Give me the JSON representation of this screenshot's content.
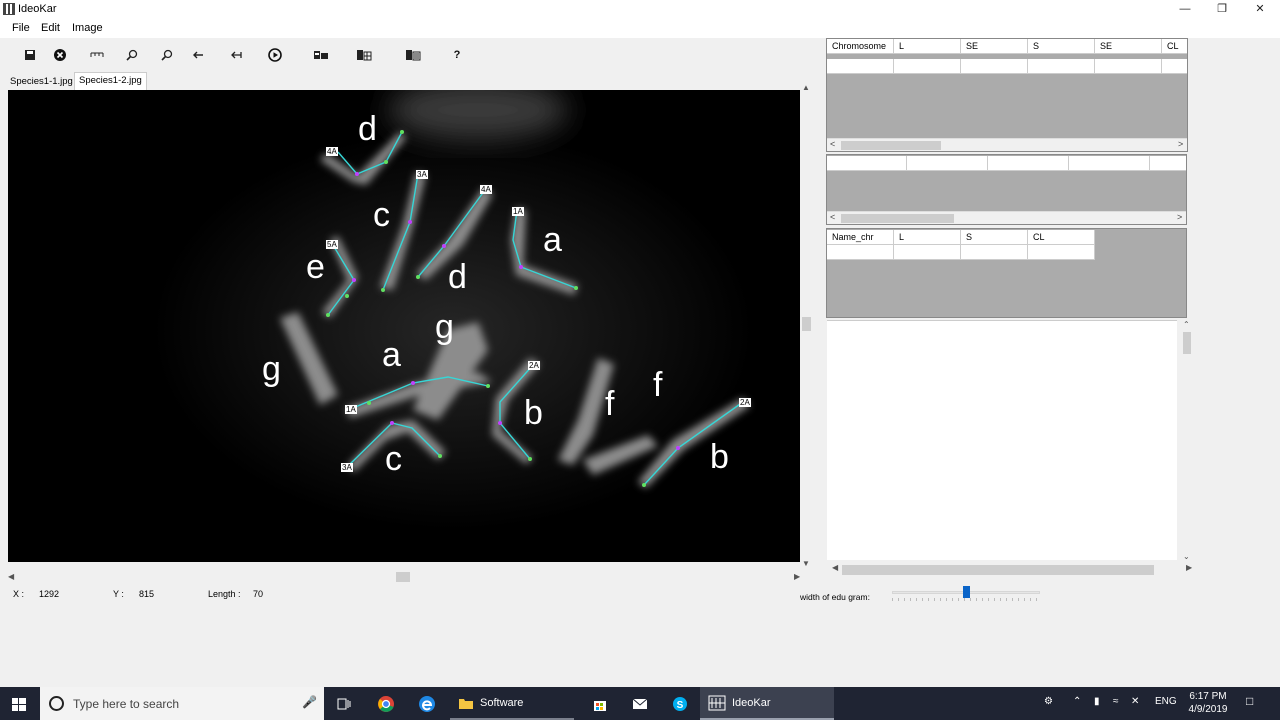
{
  "window": {
    "title": "IdeoKar",
    "min_icon": "minimize-icon",
    "max_icon": "restore-icon",
    "close_icon": "close-icon"
  },
  "menu": [
    "File",
    "Edit",
    "Image"
  ],
  "toolbar": {
    "buttons": [
      "save-icon",
      "close-image-icon",
      "measure-icon",
      "zoom-in-icon",
      "zoom-out-icon",
      "undo-arrow-icon",
      "back-arrow-icon",
      "play-icon",
      "karyotype-icon",
      "table-icon",
      "export-icon",
      "help-icon"
    ],
    "help_label": "?"
  },
  "tabs": [
    "Species1-1.jpg",
    "Species1-2.jpg"
  ],
  "image_labels": {
    "letters": [
      "d",
      "c",
      "d",
      "a",
      "e",
      "g",
      "g",
      "a",
      "b",
      "f",
      "f",
      "c",
      "b"
    ],
    "tags": [
      "4A",
      "3A",
      "4A",
      "1A",
      "5A",
      "2A",
      "1A",
      "3A",
      "2A"
    ]
  },
  "status": {
    "x_label": "X :",
    "x_value": "1292",
    "y_label": "Y :",
    "y_value": "815",
    "length_label": "Length :",
    "length_value": "70"
  },
  "table1": {
    "headers": [
      "Chromosome",
      "L",
      "SE",
      "S",
      "SE",
      "CL"
    ]
  },
  "table3": {
    "headers": [
      "Name_chr",
      "L",
      "S",
      "CL"
    ]
  },
  "slider": {
    "label": "width of edu gram:",
    "value": 0.5
  },
  "taskbar": {
    "search_placeholder": "Type here to search",
    "apps": [
      {
        "name": "Software",
        "icon": "folder-icon"
      },
      {
        "name": "IdeoKar",
        "icon": "ideokar-icon"
      }
    ],
    "language": "ENG",
    "time": "6:17 PM",
    "date": "4/9/2019"
  },
  "colors": {
    "taskbar": "#1f2433",
    "accent": "#0a64c8",
    "trace": "#36d6d6",
    "trace_node": "#c040ff"
  }
}
